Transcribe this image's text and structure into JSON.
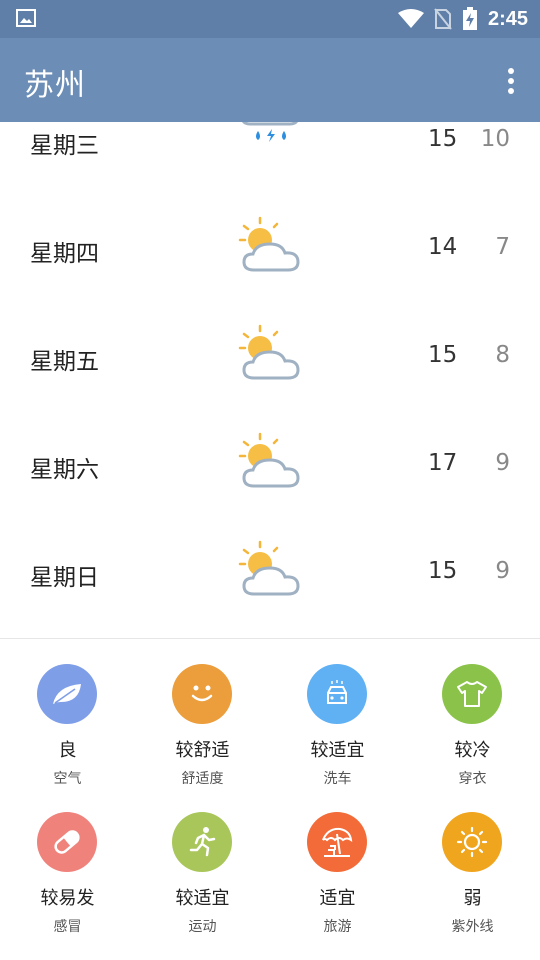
{
  "status": {
    "time": "2:45"
  },
  "appbar": {
    "title": "苏州"
  },
  "forecast": [
    {
      "day": "星期三",
      "icon": "thunder-rain-icon",
      "high": "15",
      "low": "10"
    },
    {
      "day": "星期四",
      "icon": "partly-cloudy-icon",
      "high": "14",
      "low": "7"
    },
    {
      "day": "星期五",
      "icon": "partly-cloudy-icon",
      "high": "15",
      "low": "8"
    },
    {
      "day": "星期六",
      "icon": "partly-cloudy-icon",
      "high": "17",
      "low": "9"
    },
    {
      "day": "星期日",
      "icon": "partly-cloudy-icon",
      "high": "15",
      "low": "9"
    }
  ],
  "indices": [
    {
      "level": "良",
      "category": "空气",
      "icon": "leaf-icon",
      "color": "#7f9ee8"
    },
    {
      "level": "较舒适",
      "category": "舒适度",
      "icon": "smiley-icon",
      "color": "#eb9e3b"
    },
    {
      "level": "较适宜",
      "category": "洗车",
      "icon": "car-wash-icon",
      "color": "#60b0f4"
    },
    {
      "level": "较冷",
      "category": "穿衣",
      "icon": "shirt-icon",
      "color": "#8bc34a"
    },
    {
      "level": "较易发",
      "category": "感冒",
      "icon": "pill-icon",
      "color": "#f0827c"
    },
    {
      "level": "较适宜",
      "category": "运动",
      "icon": "running-icon",
      "color": "#a9c65a"
    },
    {
      "level": "适宜",
      "category": "旅游",
      "icon": "beach-umbrella-icon",
      "color": "#f26b38"
    },
    {
      "level": "弱",
      "category": "紫外线",
      "icon": "sun-icon",
      "color": "#f0a51e"
    }
  ]
}
